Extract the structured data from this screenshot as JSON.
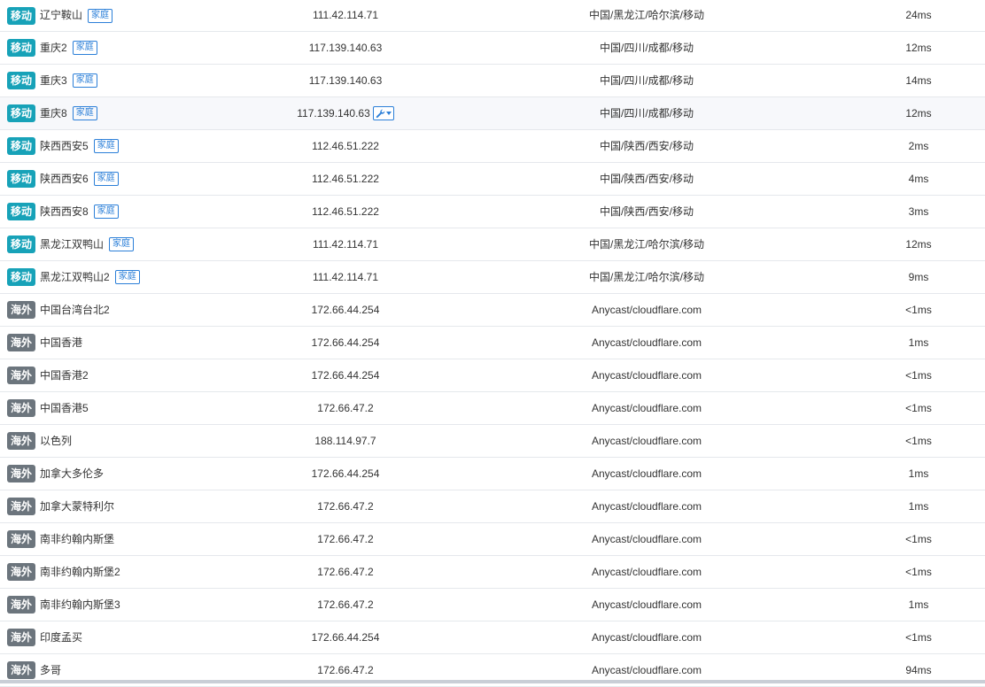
{
  "rows": [
    {
      "isp": "移动",
      "type": "mobile",
      "name": "辽宁鞍山",
      "tag": "家庭",
      "ip": "111.42.114.71",
      "location": "中国/黑龙江/哈尔滨/移动",
      "ping": "24ms"
    },
    {
      "isp": "移动",
      "type": "mobile",
      "name": "重庆2",
      "tag": "家庭",
      "ip": "117.139.140.63",
      "location": "中国/四川/成都/移动",
      "ping": "12ms"
    },
    {
      "isp": "移动",
      "type": "mobile",
      "name": "重庆3",
      "tag": "家庭",
      "ip": "117.139.140.63",
      "location": "中国/四川/成都/移动",
      "ping": "14ms"
    },
    {
      "isp": "移动",
      "type": "mobile",
      "name": "重庆8",
      "tag": "家庭",
      "ip": "117.139.140.63",
      "location": "中国/四川/成都/移动",
      "ping": "12ms",
      "hover": true
    },
    {
      "isp": "移动",
      "type": "mobile",
      "name": "陕西西安5",
      "tag": "家庭",
      "ip": "112.46.51.222",
      "location": "中国/陕西/西安/移动",
      "ping": "2ms"
    },
    {
      "isp": "移动",
      "type": "mobile",
      "name": "陕西西安6",
      "tag": "家庭",
      "ip": "112.46.51.222",
      "location": "中国/陕西/西安/移动",
      "ping": "4ms"
    },
    {
      "isp": "移动",
      "type": "mobile",
      "name": "陕西西安8",
      "tag": "家庭",
      "ip": "112.46.51.222",
      "location": "中国/陕西/西安/移动",
      "ping": "3ms"
    },
    {
      "isp": "移动",
      "type": "mobile",
      "name": "黑龙江双鸭山",
      "tag": "家庭",
      "ip": "111.42.114.71",
      "location": "中国/黑龙江/哈尔滨/移动",
      "ping": "12ms"
    },
    {
      "isp": "移动",
      "type": "mobile",
      "name": "黑龙江双鸭山2",
      "tag": "家庭",
      "ip": "111.42.114.71",
      "location": "中国/黑龙江/哈尔滨/移动",
      "ping": "9ms"
    },
    {
      "isp": "海外",
      "type": "overseas",
      "name": "中国台湾台北2",
      "tag": "",
      "ip": "172.66.44.254",
      "location": "Anycast/cloudflare.com",
      "ping": "<1ms"
    },
    {
      "isp": "海外",
      "type": "overseas",
      "name": "中国香港",
      "tag": "",
      "ip": "172.66.44.254",
      "location": "Anycast/cloudflare.com",
      "ping": "1ms"
    },
    {
      "isp": "海外",
      "type": "overseas",
      "name": "中国香港2",
      "tag": "",
      "ip": "172.66.44.254",
      "location": "Anycast/cloudflare.com",
      "ping": "<1ms"
    },
    {
      "isp": "海外",
      "type": "overseas",
      "name": "中国香港5",
      "tag": "",
      "ip": "172.66.47.2",
      "location": "Anycast/cloudflare.com",
      "ping": "<1ms"
    },
    {
      "isp": "海外",
      "type": "overseas",
      "name": "以色列",
      "tag": "",
      "ip": "188.114.97.7",
      "location": "Anycast/cloudflare.com",
      "ping": "<1ms"
    },
    {
      "isp": "海外",
      "type": "overseas",
      "name": "加拿大多伦多",
      "tag": "",
      "ip": "172.66.44.254",
      "location": "Anycast/cloudflare.com",
      "ping": "1ms"
    },
    {
      "isp": "海外",
      "type": "overseas",
      "name": "加拿大蒙特利尔",
      "tag": "",
      "ip": "172.66.47.2",
      "location": "Anycast/cloudflare.com",
      "ping": "1ms"
    },
    {
      "isp": "海外",
      "type": "overseas",
      "name": "南非约翰内斯堡",
      "tag": "",
      "ip": "172.66.47.2",
      "location": "Anycast/cloudflare.com",
      "ping": "<1ms"
    },
    {
      "isp": "海外",
      "type": "overseas",
      "name": "南非约翰内斯堡2",
      "tag": "",
      "ip": "172.66.47.2",
      "location": "Anycast/cloudflare.com",
      "ping": "<1ms"
    },
    {
      "isp": "海外",
      "type": "overseas",
      "name": "南非约翰内斯堡3",
      "tag": "",
      "ip": "172.66.47.2",
      "location": "Anycast/cloudflare.com",
      "ping": "1ms"
    },
    {
      "isp": "海外",
      "type": "overseas",
      "name": "印度孟买",
      "tag": "",
      "ip": "172.66.44.254",
      "location": "Anycast/cloudflare.com",
      "ping": "<1ms"
    },
    {
      "isp": "海外",
      "type": "overseas",
      "name": "多哥",
      "tag": "",
      "ip": "172.66.47.2",
      "location": "Anycast/cloudflare.com",
      "ping": "94ms"
    }
  ],
  "hover_tool": {
    "icon": "wrench-icon",
    "caret": "caret-down-icon"
  },
  "colors": {
    "mobile_badge": "#17a2b8",
    "overseas_badge": "#6c757d",
    "tag_blue": "#2b7fd8",
    "row_border": "#e5e8ec"
  }
}
